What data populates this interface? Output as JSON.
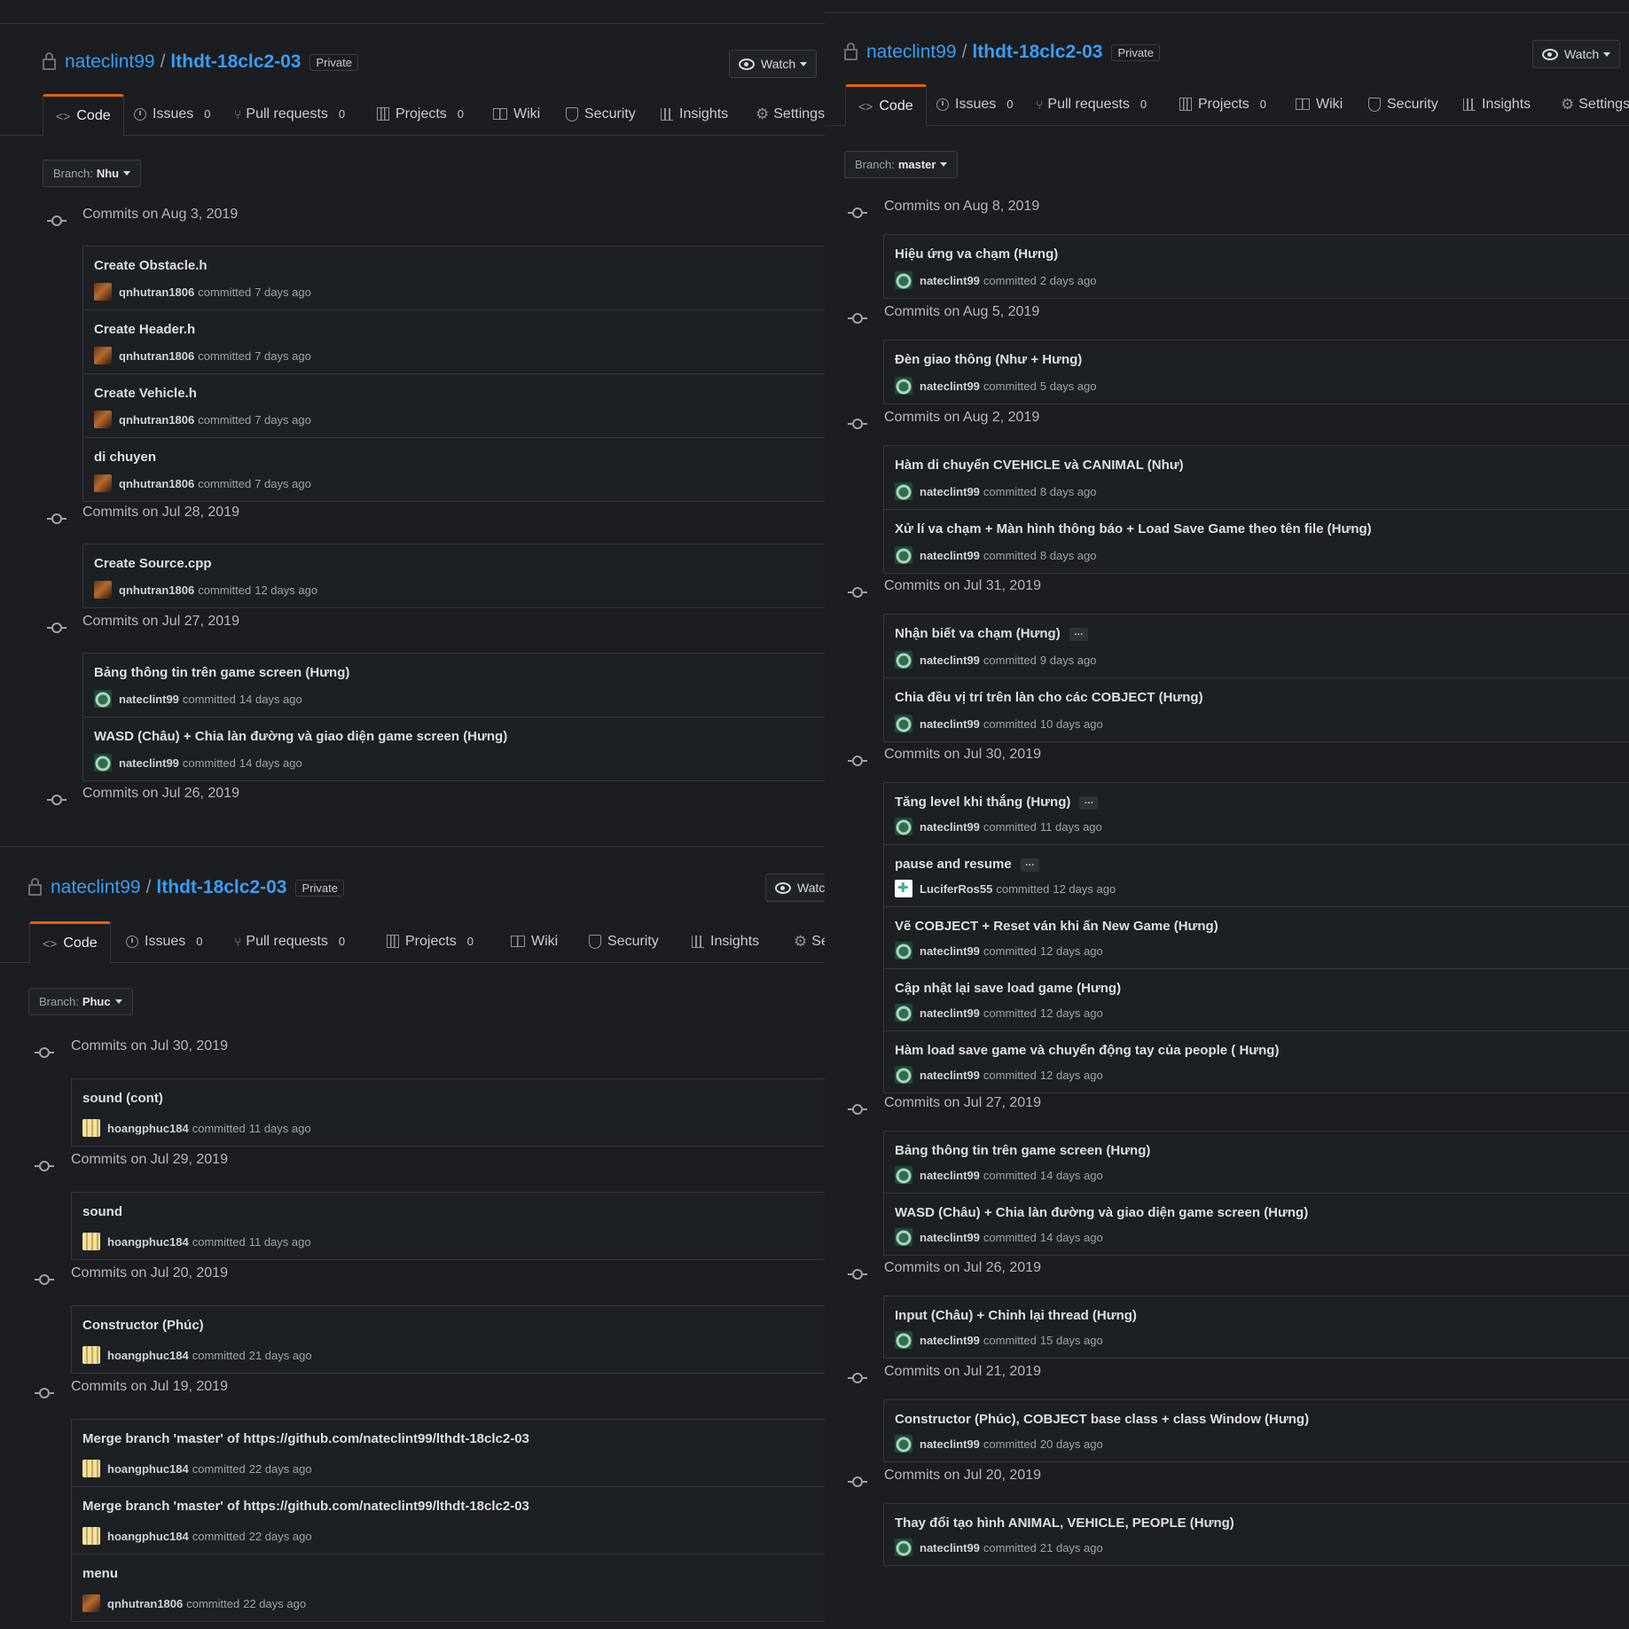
{
  "owner": "nateclint99",
  "repo": "lthdt-18clc2-03",
  "visibility": "Private",
  "watch_label": "Watch",
  "tabs": {
    "code": "Code",
    "issues": "Issues",
    "issues_count": "0",
    "pulls": "Pull requests",
    "pulls_count": "0",
    "projects": "Projects",
    "projects_count": "0",
    "wiki": "Wiki",
    "security": "Security",
    "insights": "Insights",
    "settings": "Settings",
    "settings_cut": "Se"
  },
  "watch_cut": "Watc",
  "branch_label": "Branch:",
  "panel1": {
    "branch": "Nhu",
    "days": [
      {
        "header": "Commits on Aug 3, 2019",
        "commits": [
          {
            "msg": "Create Obstacle.h",
            "author": "qnhutran1806",
            "action": "committed",
            "time": "7 days ago"
          },
          {
            "msg": "Create Header.h",
            "author": "qnhutran1806",
            "action": "committed",
            "time": "7 days ago"
          },
          {
            "msg": "Create Vehicle.h",
            "author": "qnhutran1806",
            "action": "committed",
            "time": "7 days ago"
          },
          {
            "msg": "di chuyen",
            "author": "qnhutran1806",
            "action": "committed",
            "time": "7 days ago"
          }
        ]
      },
      {
        "header": "Commits on Jul 28, 2019",
        "commits": [
          {
            "msg": "Create Source.cpp",
            "author": "qnhutran1806",
            "action": "committed",
            "time": "12 days ago"
          }
        ]
      },
      {
        "header": "Commits on Jul 27, 2019",
        "commits": [
          {
            "msg": "Bảng thông tin trên game screen (Hưng)",
            "author": "nateclint99",
            "action": "committed",
            "time": "14 days ago"
          },
          {
            "msg": "WASD (Châu) + Chia làn đường và giao diện game screen (Hưng)",
            "author": "nateclint99",
            "action": "committed",
            "time": "14 days ago"
          }
        ]
      },
      {
        "header": "Commits on Jul 26, 2019",
        "commits": []
      }
    ]
  },
  "panel2": {
    "branch": "master",
    "days": [
      {
        "header": "Commits on Aug 8, 2019",
        "commits": [
          {
            "msg": "Hiệu ứng va chạm (Hưng)",
            "author": "nateclint99",
            "action": "committed",
            "time": "2 days ago"
          }
        ]
      },
      {
        "header": "Commits on Aug 5, 2019",
        "commits": [
          {
            "msg": "Đèn giao thông (Như + Hưng)",
            "author": "nateclint99",
            "action": "committed",
            "time": "5 days ago"
          }
        ]
      },
      {
        "header": "Commits on Aug 2, 2019",
        "commits": [
          {
            "msg": "Hàm di chuyển CVEHICLE và CANIMAL (Như)",
            "author": "nateclint99",
            "action": "committed",
            "time": "8 days ago"
          },
          {
            "msg": "Xử lí va chạm + Màn hình thông báo + Load Save Game theo tên file (Hưng)",
            "author": "nateclint99",
            "action": "committed",
            "time": "8 days ago"
          }
        ]
      },
      {
        "header": "Commits on Jul 31, 2019",
        "commits": [
          {
            "msg": "Nhận biết va chạm (Hưng)",
            "author": "nateclint99",
            "action": "committed",
            "time": "9 days ago",
            "more": "…"
          },
          {
            "msg": "Chia đều vị trí trên làn cho các COBJECT (Hưng)",
            "author": "nateclint99",
            "action": "committed",
            "time": "10 days ago"
          }
        ]
      },
      {
        "header": "Commits on Jul 30, 2019",
        "commits": [
          {
            "msg": "Tăng level khi thắng (Hưng)",
            "author": "nateclint99",
            "action": "committed",
            "time": "11 days ago",
            "more": "…"
          },
          {
            "msg": "pause and resume",
            "author": "LuciferRos55",
            "action": "committed",
            "time": "12 days ago",
            "more": "…"
          },
          {
            "msg": "Vẽ COBJECT + Reset ván khi ấn New Game (Hưng)",
            "author": "nateclint99",
            "action": "committed",
            "time": "12 days ago"
          },
          {
            "msg": "Cập nhật lại save load game (Hưng)",
            "author": "nateclint99",
            "action": "committed",
            "time": "12 days ago"
          },
          {
            "msg": "Hàm load save game và chuyển động tay của people ( Hưng)",
            "author": "nateclint99",
            "action": "committed",
            "time": "12 days ago"
          }
        ]
      },
      {
        "header": "Commits on Jul 27, 2019",
        "commits": [
          {
            "msg": "Bảng thông tin trên game screen (Hưng)",
            "author": "nateclint99",
            "action": "committed",
            "time": "14 days ago"
          },
          {
            "msg": "WASD (Châu) + Chia làn đường và giao diện game screen (Hưng)",
            "author": "nateclint99",
            "action": "committed",
            "time": "14 days ago"
          }
        ]
      },
      {
        "header": "Commits on Jul 26, 2019",
        "commits": [
          {
            "msg": "Input (Châu) + Chỉnh lại thread (Hưng)",
            "author": "nateclint99",
            "action": "committed",
            "time": "15 days ago"
          }
        ]
      },
      {
        "header": "Commits on Jul 21, 2019",
        "commits": [
          {
            "msg": "Constructor (Phúc), COBJECT base class + class Window (Hưng)",
            "author": "nateclint99",
            "action": "committed",
            "time": "20 days ago"
          }
        ]
      },
      {
        "header": "Commits on Jul 20, 2019",
        "commits": [
          {
            "msg": "Thay đổi tạo hình ANIMAL, VEHICLE, PEOPLE (Hưng)",
            "author": "nateclint99",
            "action": "committed",
            "time": "21 days ago"
          }
        ]
      }
    ]
  },
  "panel3": {
    "branch": "Phuc",
    "days": [
      {
        "header": "Commits on Jul 30, 2019",
        "commits": [
          {
            "msg": "sound (cont)",
            "author": "hoangphuc184",
            "action": "committed",
            "time": "11 days ago"
          }
        ]
      },
      {
        "header": "Commits on Jul 29, 2019",
        "commits": [
          {
            "msg": "sound",
            "author": "hoangphuc184",
            "action": "committed",
            "time": "11 days ago"
          }
        ]
      },
      {
        "header": "Commits on Jul 20, 2019",
        "commits": [
          {
            "msg": "Constructor (Phúc)",
            "author": "hoangphuc184",
            "action": "committed",
            "time": "21 days ago"
          }
        ]
      },
      {
        "header": "Commits on Jul 19, 2019",
        "commits": [
          {
            "msg": "Merge branch 'master' of https://github.com/nateclint99/lthdt-18clc2-03",
            "author": "hoangphuc184",
            "action": "committed",
            "time": "22 days ago"
          },
          {
            "msg": "Merge branch 'master' of https://github.com/nateclint99/lthdt-18clc2-03",
            "author": "hoangphuc184",
            "action": "committed",
            "time": "22 days ago"
          },
          {
            "msg": "menu",
            "author": "qnhutran1806",
            "action": "committed",
            "time": "22 days ago"
          }
        ]
      }
    ]
  },
  "colors": {
    "accent": "#3b9cf5",
    "tab_active_border": "#e36209",
    "background": "#1b1d20"
  }
}
